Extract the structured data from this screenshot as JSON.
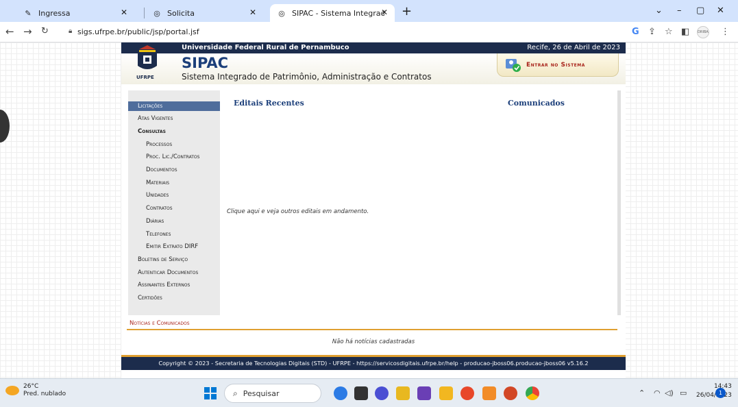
{
  "browser": {
    "tabs": [
      {
        "title": "Ingressa",
        "icon": "feather-icon"
      },
      {
        "title": "Solicita",
        "icon": "globe-icon"
      },
      {
        "title": "SIPAC - Sistema Integrado de Pat",
        "icon": "globe-icon"
      }
    ],
    "url": "sigs.ufrpe.br/public/jsp/portal.jsf",
    "profile_label": "DRIBA"
  },
  "site": {
    "university": "Universidade Federal Rural de Pernambuco",
    "date": "Recife, 26 de Abril de 2023",
    "logo_text": "UFRPE",
    "app_name": "SIPAC",
    "app_subtitle": "Sistema Integrado de Patrimônio, Administração e Contratos",
    "login_label": "Entrar no Sistema"
  },
  "menu": {
    "items": [
      {
        "label": "Licitações"
      },
      {
        "label": "Atas Vigentes"
      },
      {
        "label": "Consultas"
      },
      {
        "label": "Processos"
      },
      {
        "label": "Proc. Lic./Contratos"
      },
      {
        "label": "Documentos"
      },
      {
        "label": "Materiais"
      },
      {
        "label": "Unidades"
      },
      {
        "label": "Contratos"
      },
      {
        "label": "Diárias"
      },
      {
        "label": "Telefones"
      },
      {
        "label": "Emitir Extrato DIRF"
      },
      {
        "label": "Boletins de Serviço"
      },
      {
        "label": "Autenticar Documentos"
      },
      {
        "label": "Assinantes Externos"
      },
      {
        "label": "Certidões"
      }
    ]
  },
  "content": {
    "editais_title": "Editais Recentes",
    "comunicados_title": "Comunicados",
    "more_link": "Clique aqui e veja outros editais em andamento."
  },
  "news": {
    "title": "Notícias e Comunicados",
    "empty": "Não há notícias cadastradas"
  },
  "footer": {
    "text": "Copyright © 2023 - Secretaria de Tecnologias Digitais (STD) - UFRPE - https://servicosdigitais.ufrpe.br/help - producao-jboss06.producao-jboss06 v5.16.2"
  },
  "taskbar": {
    "temperature": "26°C",
    "weather": "Pred. nublado",
    "search_placeholder": "Pesquisar",
    "time": "14:43",
    "date": "26/04/2023",
    "notifications": "1"
  }
}
